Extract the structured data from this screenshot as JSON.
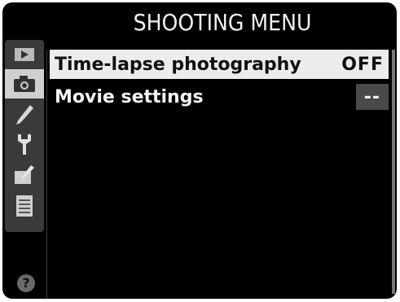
{
  "header": {
    "title": "SHOOTING MENU"
  },
  "sidebar": {
    "items": [
      {
        "icon": "playback-icon",
        "active": false
      },
      {
        "icon": "camera-icon",
        "active": true
      },
      {
        "icon": "pencil-icon",
        "active": false
      },
      {
        "icon": "wrench-icon",
        "active": false
      },
      {
        "icon": "retouch-icon",
        "active": false
      },
      {
        "icon": "recent-settings-icon",
        "active": false
      }
    ]
  },
  "menu": {
    "items": [
      {
        "label": "Time-lapse photography",
        "value": "OFF",
        "selected": true
      },
      {
        "label": "Movie settings",
        "value": "--",
        "selected": false
      }
    ]
  },
  "help": {
    "label": "?"
  },
  "colors": {
    "background": "#000000",
    "highlight": "#ececec",
    "sidebar": "#3a3a3a"
  }
}
